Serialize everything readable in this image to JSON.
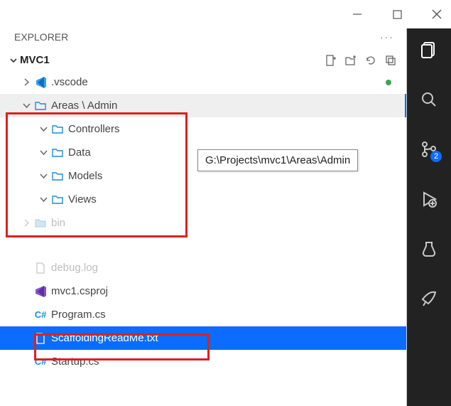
{
  "titlebar": {},
  "explorer": {
    "title": "EXPLORER"
  },
  "project": {
    "name": "MVC1"
  },
  "tree": {
    "vscode": ".vscode",
    "areas_admin": "Areas \\ Admin",
    "controllers": "Controllers",
    "data": "Data",
    "models": "Models",
    "views": "Views",
    "bin": "bin",
    "debug_log": "debug.log",
    "mvc1_csproj": "mvc1.csproj",
    "program_cs": "Program.cs",
    "scaffolding": "ScaffoldingReadMe.txt",
    "startup_cs": "Startup.cs"
  },
  "tooltip": {
    "path": "G:\\Projects\\mvc1\\Areas\\Admin"
  },
  "activitybar": {
    "scm_badge": "2"
  },
  "icons": {
    "cs": "C#"
  }
}
